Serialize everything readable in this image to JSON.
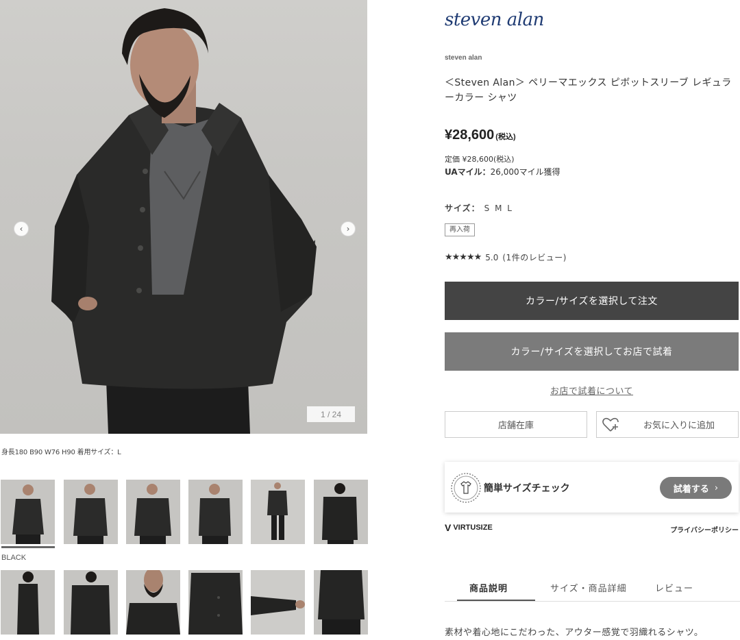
{
  "gallery": {
    "counter": "1 / 24",
    "caption": "身長180 B90 W76 H90 着用サイズ：L",
    "color_label": "BLACK",
    "prev_icon": "chevron-left-icon",
    "next_icon": "chevron-right-icon"
  },
  "product": {
    "brand_logo": "steven alan",
    "brand_name": "steven alan",
    "title": "＜Steven Alan＞ ペリーマエックス ピボットスリーブ レギュラーカラー シャツ",
    "price": "¥28,600",
    "price_tax": "(税込)",
    "list_price": "定価 ¥28,600(税込)",
    "miles_label": "UAマイル：",
    "miles_value": "26,000マイル獲得",
    "size_label": "サイズ：",
    "sizes": "S M L",
    "restock_badge": "再入荷",
    "stars": "★★★★★",
    "rating_value": "5.0",
    "rating_count": "(1件のレビュー)"
  },
  "actions": {
    "order_label": "カラー/サイズを選択して注文",
    "tryon_label": "カラー/サイズを選択してお店で試着",
    "tryon_link": "お店で試着について",
    "stock_label": "店舗在庫",
    "favorite_label": "お気に入りに追加"
  },
  "size_check": {
    "label": "簡単サイズチェック",
    "button_label": "試着する",
    "button_chevron": "›",
    "brand": "VIRTUSIZE",
    "brand_mark": "V",
    "privacy": "プライバシーポリシー"
  },
  "tabs": {
    "description": "商品説明",
    "size_detail": "サイズ・商品詳細",
    "review": "レビュー"
  },
  "description_text": "素材や着心地にこだわった、アウター感覚で羽織れるシャツ。"
}
